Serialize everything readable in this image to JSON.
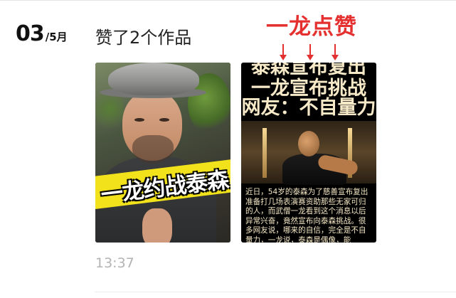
{
  "date": {
    "day": "03",
    "month": "/5月"
  },
  "activity": {
    "title": "赞了2个作品",
    "time": "13:37"
  },
  "annotation": {
    "text": "一龙点赞",
    "color": "#e43130"
  },
  "works": [
    {
      "caption": "一龙约战泰森"
    },
    {
      "headline": [
        "泰森宣布复出",
        "一龙宣布挑战",
        "网友：不自量力"
      ],
      "body": "近日，54岁的泰森为了慈善宣布复出准备打几场表演赛资助那些无家可归的人，而武僧一龙看到这个消息以后异常兴奋，竟然宣布向泰森挑战。很多网友说，哪来的自信，完全是不自量力，一龙说，泰森是偶像，能"
    }
  ],
  "icons": {
    "arrow": "down-arrow-icon"
  }
}
